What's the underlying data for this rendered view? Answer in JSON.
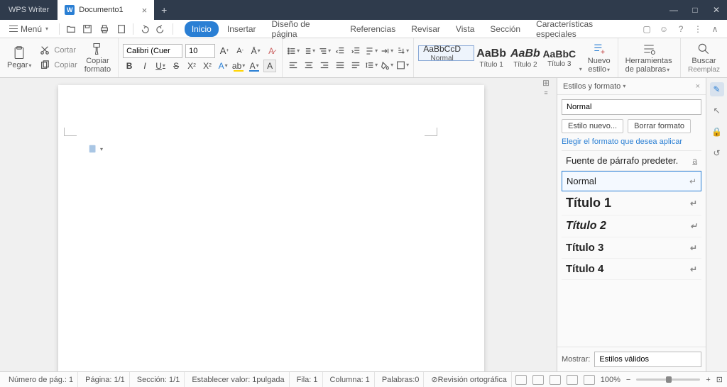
{
  "titlebar": {
    "app": "WPS Writer",
    "doc": "Documento1"
  },
  "menu_label": "Menú",
  "tabs": [
    "Inicio",
    "Insertar",
    "Diseño de página",
    "Referencias",
    "Revisar",
    "Vista",
    "Sección",
    "Características especiales"
  ],
  "active_tab": 0,
  "ribbon": {
    "paste": "Pegar",
    "cut": "Cortar",
    "copy": "Copiar",
    "copy_fmt": "Copiar formato",
    "font_name": "Calibri (Cuerpo)",
    "font_size": "10",
    "style_previews": [
      {
        "sample": "AaBbCcD",
        "label": "Normal"
      },
      {
        "sample": "AaBb",
        "label": "Título 1"
      },
      {
        "sample": "AaBb",
        "label": "Título 2"
      },
      {
        "sample": "AaBbC",
        "label": "Título 3"
      }
    ],
    "new_style": "Nuevo estilo",
    "word_tools": "Herramientas de palabras",
    "find": "Buscar",
    "replace": "Reemplaz"
  },
  "panel": {
    "title": "Estilos y formato",
    "current": "Normal",
    "new_btn": "Estilo nuevo...",
    "clear_btn": "Borrar formato",
    "prompt": "Elegir el formato que desea aplicar",
    "items": [
      {
        "label": "Fuente de párrafo predeter.",
        "mark": "a"
      },
      {
        "label": "Normal",
        "mark": "↵"
      },
      {
        "label": "Título 1",
        "mark": "↵"
      },
      {
        "label": "Título 2",
        "mark": "↵"
      },
      {
        "label": "Título 3",
        "mark": "↵"
      },
      {
        "label": "Título 4",
        "mark": "↵"
      }
    ],
    "show_label": "Mostrar:",
    "show_value": "Estilos válidos"
  },
  "status": {
    "page_no": "Número de pág.: 1",
    "page": "Página: 1/1",
    "section": "Sección: 1/1",
    "ruler": "Establecer valor: 1pulgada",
    "row": "Fila: 1",
    "col": "Columna: 1",
    "words": "Palabras:0",
    "spell": "Revisión ortográfica",
    "zoom": "100%"
  }
}
